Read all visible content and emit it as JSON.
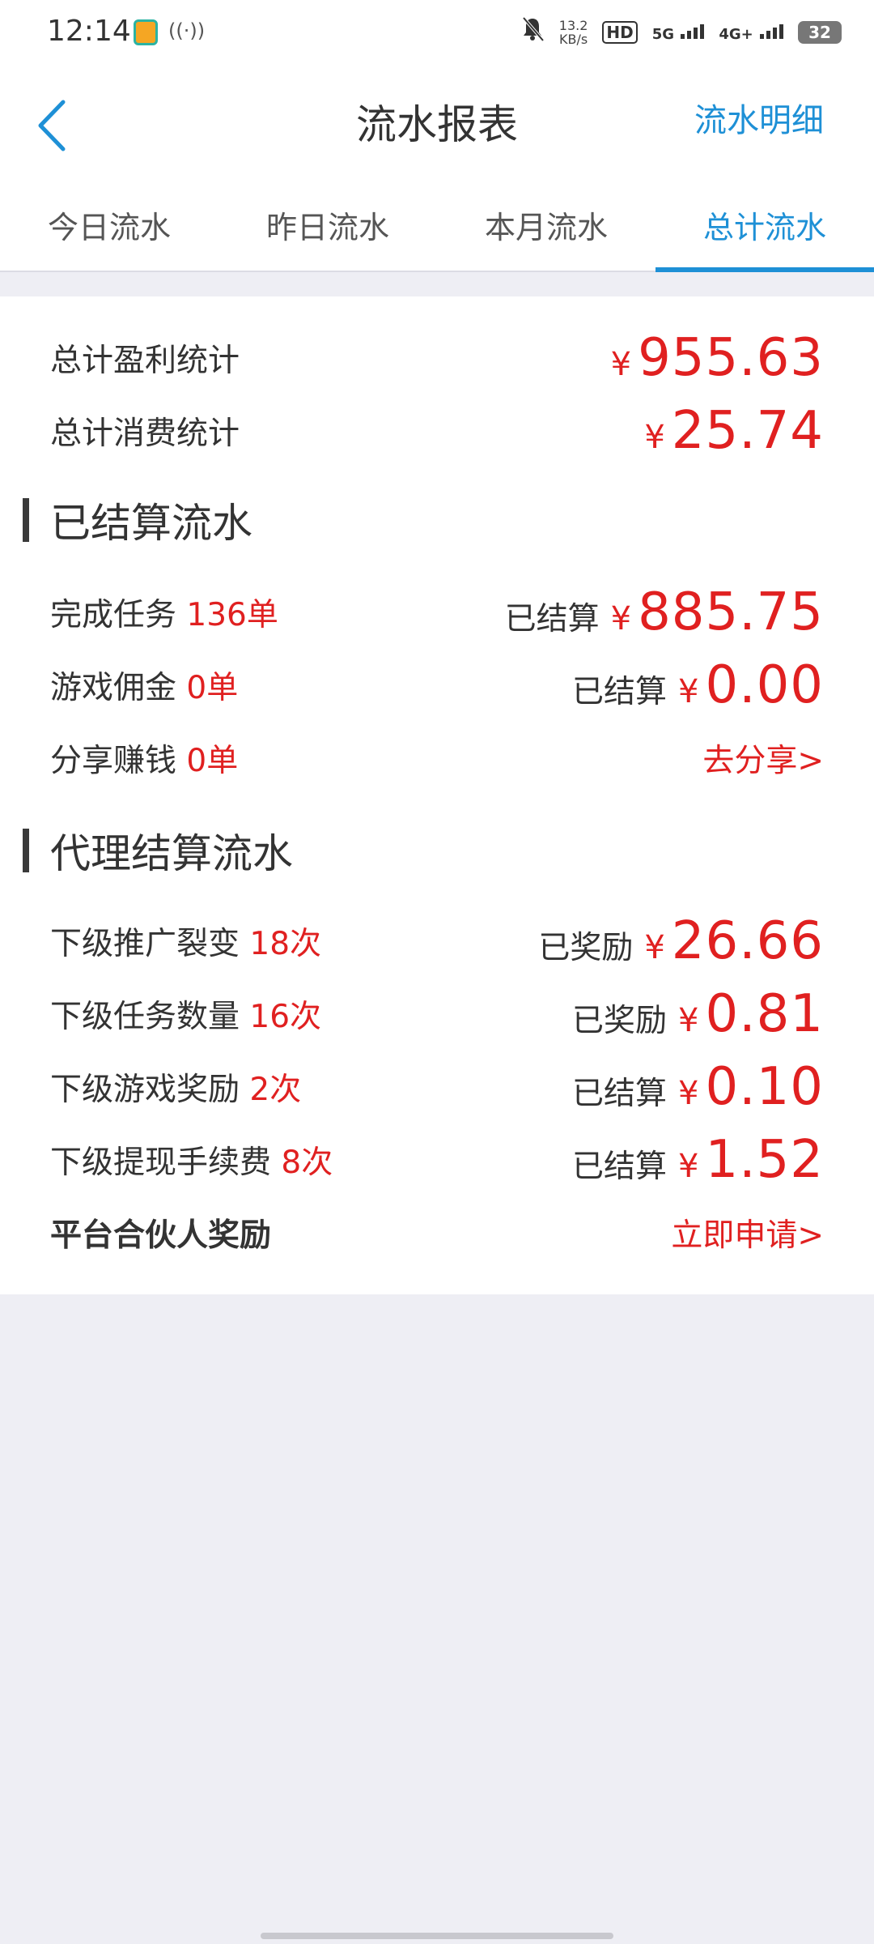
{
  "status_bar": {
    "time": "12:14",
    "speed_value": "13.2",
    "speed_unit": "KB/s",
    "hd": "HD",
    "net1": "5G",
    "net2": "4G+",
    "battery": "32"
  },
  "nav": {
    "title": "流水报表",
    "detail_link": "流水明细"
  },
  "tabs": [
    {
      "label": "今日流水"
    },
    {
      "label": "昨日流水"
    },
    {
      "label": "本月流水"
    },
    {
      "label": "总计流水"
    }
  ],
  "summary": {
    "profit_label": "总计盈利统计",
    "profit_yen": "¥",
    "profit_amount": "955.63",
    "spend_label": "总计消费统计",
    "spend_yen": "¥",
    "spend_amount": "25.74"
  },
  "settled": {
    "title": "已结算流水",
    "rows": [
      {
        "label": "完成任务",
        "count": "136单",
        "status": "已结算",
        "yen": "¥",
        "amount": "885.75"
      },
      {
        "label": "游戏佣金",
        "count": "0单",
        "status": "已结算",
        "yen": "¥",
        "amount": "0.00"
      },
      {
        "label": "分享赚钱",
        "count": "0单",
        "action": "去分享>"
      }
    ]
  },
  "agent": {
    "title": "代理结算流水",
    "rows": [
      {
        "label": "下级推广裂变",
        "count": "18次",
        "status": "已奖励",
        "yen": "¥",
        "amount": "26.66"
      },
      {
        "label": "下级任务数量",
        "count": "16次",
        "status": "已奖励",
        "yen": "¥",
        "amount": "0.81"
      },
      {
        "label": "下级游戏奖励",
        "count": "2次",
        "status": "已结算",
        "yen": "¥",
        "amount": "0.10"
      },
      {
        "label": "下级提现手续费",
        "count": "8次",
        "status": "已结算",
        "yen": "¥",
        "amount": "1.52"
      }
    ],
    "partner_label": "平台合伙人奖励",
    "partner_action": "立即申请>"
  },
  "colors": {
    "accent": "#1e90d6",
    "amount_red": "#e02020",
    "background": "#eeeef4"
  }
}
